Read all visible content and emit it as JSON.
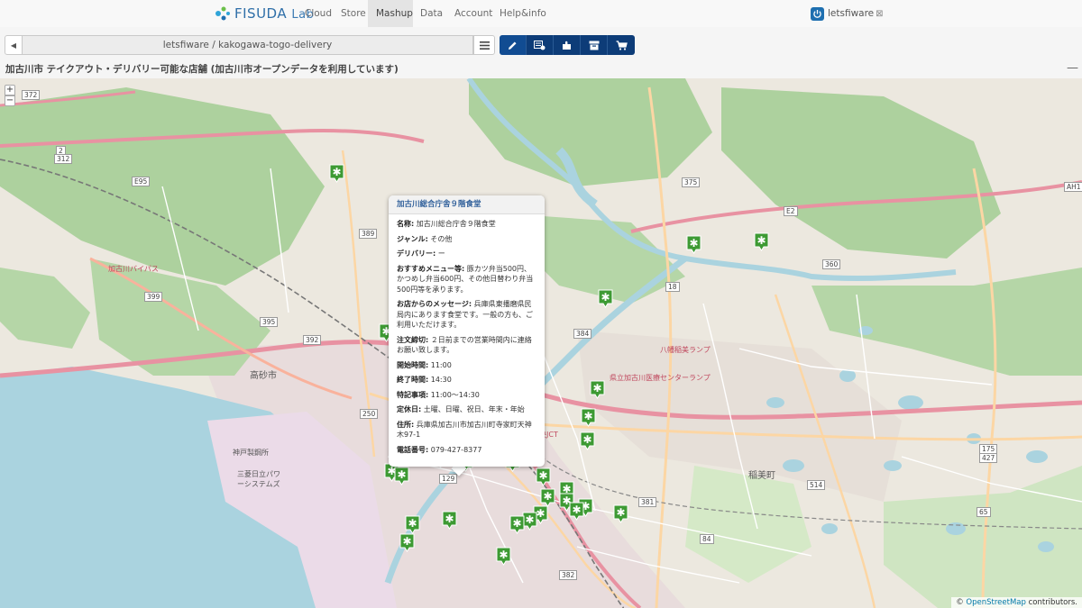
{
  "nav": {
    "logo_main": "FISUDA",
    "logo_sub": "Lab",
    "links": [
      {
        "label": "Cloud",
        "active": false
      },
      {
        "label": "Store",
        "active": false
      },
      {
        "label": "Mashup",
        "active": true
      },
      {
        "label": "Data",
        "active": false
      },
      {
        "label": "Account",
        "active": false
      },
      {
        "label": "Help&info",
        "active": false
      }
    ],
    "user": "letsfiware",
    "user_ext": "⊠"
  },
  "toolbar": {
    "path": "letsfiware / kakogawa-togo-delivery",
    "tools": [
      "edit-icon",
      "wiring-icon",
      "component-icon",
      "archive-icon",
      "cart-icon"
    ]
  },
  "page": {
    "title": "加古川市 テイクアウト・デリバリー可能な店舗 (加古川市オープンデータを利用しています)"
  },
  "map": {
    "zoom_in": "+",
    "zoom_out": "−",
    "labels": {
      "takasago": "高砂市",
      "inami": "稲美町",
      "sanyo_kokusaku": "三菱日立パワーシステムズ",
      "kobe_works": "神戸製鋼所",
      "kakogawa_bypass": "加古川バイパス",
      "kakogawa_jct": "加古川中央JCT",
      "kakogawa_hospital": "県立加古川医療センターランプ",
      "hachiman": "八幡稲美ランプ"
    },
    "shields": [
      "372",
      "2",
      "312",
      "E95",
      "389",
      "399",
      "395",
      "392",
      "250",
      "129",
      "382",
      "381",
      "384",
      "18",
      "360",
      "375",
      "E2",
      "AH1",
      "514",
      "175",
      "427",
      "84",
      "65"
    ],
    "attribution_prefix": "©",
    "attribution_link": "OpenStreetMap",
    "attribution_suffix": "contributors.",
    "marker_color": "#3d9a33"
  },
  "popup": {
    "title": "加古川総合庁舎９階食堂",
    "rows": [
      {
        "key": "名称:",
        "value": "加古川総合庁舎９階食堂"
      },
      {
        "key": "ジャンル:",
        "value": "その他"
      },
      {
        "key": "デリバリー:",
        "value": "ー"
      },
      {
        "key": "おすすめメニュー等:",
        "value": "豚カツ弁当500円、かつめし弁当600円、その他日替わり弁当500円等を承ります。"
      },
      {
        "key": "お店からのメッセージ:",
        "value": "兵庫県東播磨県民局内にあります食堂です。一般の方も、ご利用いただけます。"
      },
      {
        "key": "注文締切:",
        "value": "２日前までの営業時間内に連絡お願い致します。"
      },
      {
        "key": "開始時間:",
        "value": "11:00"
      },
      {
        "key": "終了時間:",
        "value": "14:30"
      },
      {
        "key": "特記事項:",
        "value": "11:00〜14:30"
      },
      {
        "key": "定休日:",
        "value": "土曜、日曜、祝日、年末・年始"
      },
      {
        "key": "住所:",
        "value": "兵庫県加古川市加古川町寺家町天神木97-1"
      },
      {
        "key": "電話番号:",
        "value": "079-427-8377"
      }
    ]
  }
}
